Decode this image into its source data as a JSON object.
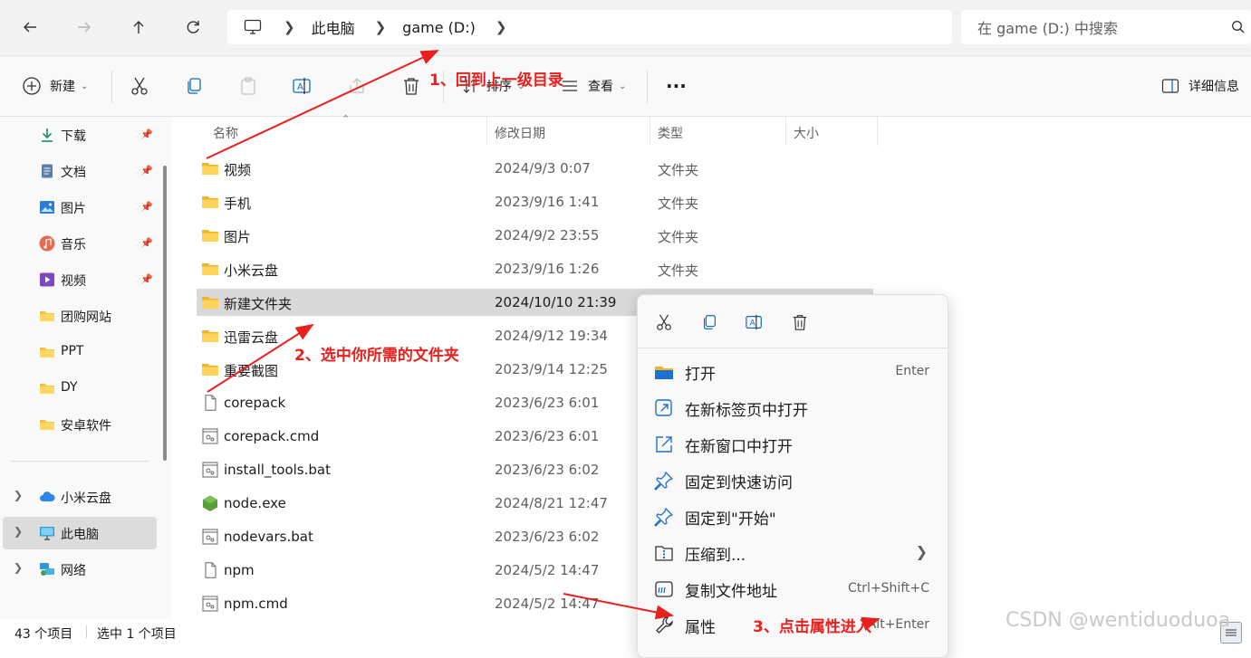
{
  "address_bar": {
    "breadcrumbs": [
      "此电脑",
      "game (D:)"
    ],
    "search_placeholder": "在 game (D:) 中搜索"
  },
  "command_bar": {
    "new_label": "新建",
    "sort_label": "排序",
    "view_label": "查看",
    "more_label": "···",
    "details_label": "详细信息"
  },
  "sidebar": {
    "quick_access": [
      {
        "label": "下载",
        "icon": "download-icon",
        "pinned": true
      },
      {
        "label": "文档",
        "icon": "document-icon",
        "pinned": true
      },
      {
        "label": "图片",
        "icon": "pictures-icon",
        "pinned": true
      },
      {
        "label": "音乐",
        "icon": "music-icon",
        "pinned": true
      },
      {
        "label": "视频",
        "icon": "video-icon",
        "pinned": true
      },
      {
        "label": "团购网站",
        "icon": "folder-icon",
        "pinned": false
      },
      {
        "label": "PPT",
        "icon": "folder-icon",
        "pinned": false
      },
      {
        "label": "DY",
        "icon": "folder-icon",
        "pinned": false
      },
      {
        "label": "安卓软件",
        "icon": "folder-icon",
        "pinned": false
      }
    ],
    "locations": [
      {
        "label": "小米云盘",
        "icon": "cloud-icon"
      },
      {
        "label": "此电脑",
        "icon": "computer-icon",
        "selected": true
      },
      {
        "label": "网络",
        "icon": "network-icon"
      }
    ]
  },
  "file_list": {
    "columns": [
      "名称",
      "修改日期",
      "类型",
      "大小"
    ],
    "rows": [
      {
        "name": "视频",
        "date": "2024/9/3 0:07",
        "type": "文件夹",
        "icon": "folder-icon"
      },
      {
        "name": "手机",
        "date": "2023/9/16 1:41",
        "type": "文件夹",
        "icon": "folder-icon"
      },
      {
        "name": "图片",
        "date": "2024/9/2 23:55",
        "type": "文件夹",
        "icon": "folder-icon"
      },
      {
        "name": "小米云盘",
        "date": "2023/9/16 1:26",
        "type": "文件夹",
        "icon": "folder-icon"
      },
      {
        "name": "新建文件夹",
        "date": "2024/10/10 21:39",
        "type": "",
        "icon": "folder-icon",
        "selected": true
      },
      {
        "name": "迅雷云盘",
        "date": "2024/9/12 19:34",
        "type": "",
        "icon": "folder-icon"
      },
      {
        "name": "重要截图",
        "date": "2023/9/14 12:25",
        "type": "",
        "icon": "folder-icon"
      },
      {
        "name": "corepack",
        "date": "2023/6/23 6:01",
        "type": "",
        "icon": "file-icon"
      },
      {
        "name": "corepack.cmd",
        "date": "2023/6/23 6:01",
        "type": "",
        "icon": "script-icon"
      },
      {
        "name": "install_tools.bat",
        "date": "2023/6/23 6:02",
        "type": "",
        "icon": "script-icon"
      },
      {
        "name": "node.exe",
        "date": "2024/8/21 12:47",
        "type": "",
        "icon": "node-icon"
      },
      {
        "name": "nodevars.bat",
        "date": "2023/6/23 6:02",
        "type": "",
        "icon": "script-icon"
      },
      {
        "name": "npm",
        "date": "2024/5/2 14:47",
        "type": "",
        "icon": "file-icon"
      },
      {
        "name": "npm.cmd",
        "date": "2024/5/2 14:47",
        "type": "",
        "icon": "script-icon"
      }
    ]
  },
  "context_menu": {
    "items": [
      {
        "label": "打开",
        "shortcut": "Enter",
        "icon": "open-folder-icon"
      },
      {
        "label": "在新标签页中打开",
        "shortcut": "",
        "icon": "new-tab-icon"
      },
      {
        "label": "在新窗口中打开",
        "shortcut": "",
        "icon": "new-window-icon"
      },
      {
        "label": "固定到快速访问",
        "shortcut": "",
        "icon": "pin-icon"
      },
      {
        "label": "固定到\"开始\"",
        "shortcut": "",
        "icon": "pin-start-icon"
      },
      {
        "label": "压缩到...",
        "shortcut": "",
        "icon": "zip-icon",
        "submenu": true
      },
      {
        "label": "复制文件地址",
        "shortcut": "Ctrl+Shift+C",
        "icon": "copy-path-icon"
      },
      {
        "label": "属性",
        "shortcut": "Alt+Enter",
        "icon": "properties-icon"
      }
    ]
  },
  "status_bar": {
    "item_count": "43 个项目",
    "selection": "选中 1 个项目"
  },
  "annotations": {
    "step1": "1、回到上一级目录",
    "step2": "2、选中你所需的文件夹",
    "step3": "3、点击属性进入",
    "annotation_color": "#e8201e"
  },
  "watermark": "CSDN @wentiduoduoa",
  "colors": {
    "folder_yellow": "#f5c342",
    "selection_gray": "#d9d9d9",
    "accent_blue": "#0f6cbd"
  }
}
